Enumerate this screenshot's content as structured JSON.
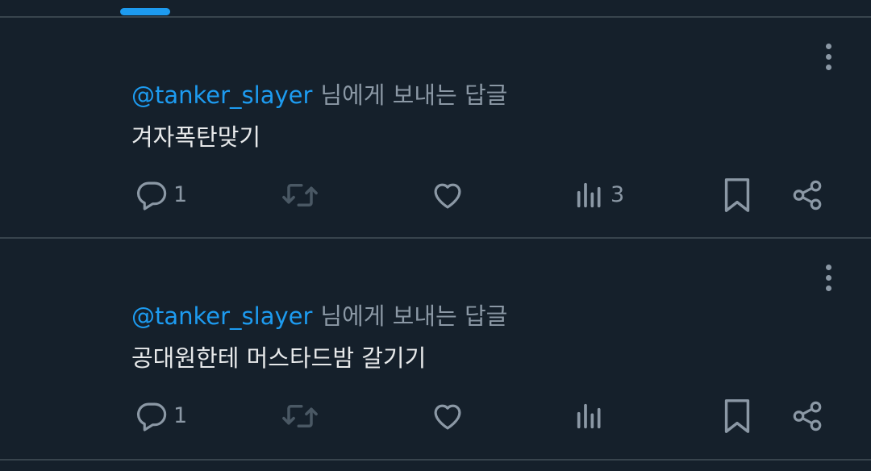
{
  "colors": {
    "background": "#15202b",
    "accent": "#1d9bf0",
    "muted": "#8b98a5",
    "dim_icon": "#4a5864",
    "text": "#e7e9ea",
    "divider": "#38444d"
  },
  "tweets": [
    {
      "reply_handle": "@tanker_slayer",
      "reply_suffix": "님에게 보내는 답글",
      "text": "겨자폭탄맞기",
      "reply_count": "1",
      "view_count": "3",
      "icons": [
        "more-vertical-icon",
        "comment-icon",
        "retweet-icon",
        "heart-icon",
        "bar-chart-icon",
        "bookmark-icon",
        "share-icon"
      ]
    },
    {
      "reply_handle": "@tanker_slayer",
      "reply_suffix": "님에게 보내는 답글",
      "text": "공대원한테 머스타드밤 갈기기",
      "reply_count": "1",
      "view_count": "",
      "icons": [
        "more-vertical-icon",
        "comment-icon",
        "retweet-icon",
        "heart-icon",
        "bar-chart-icon",
        "bookmark-icon",
        "share-icon"
      ]
    }
  ]
}
